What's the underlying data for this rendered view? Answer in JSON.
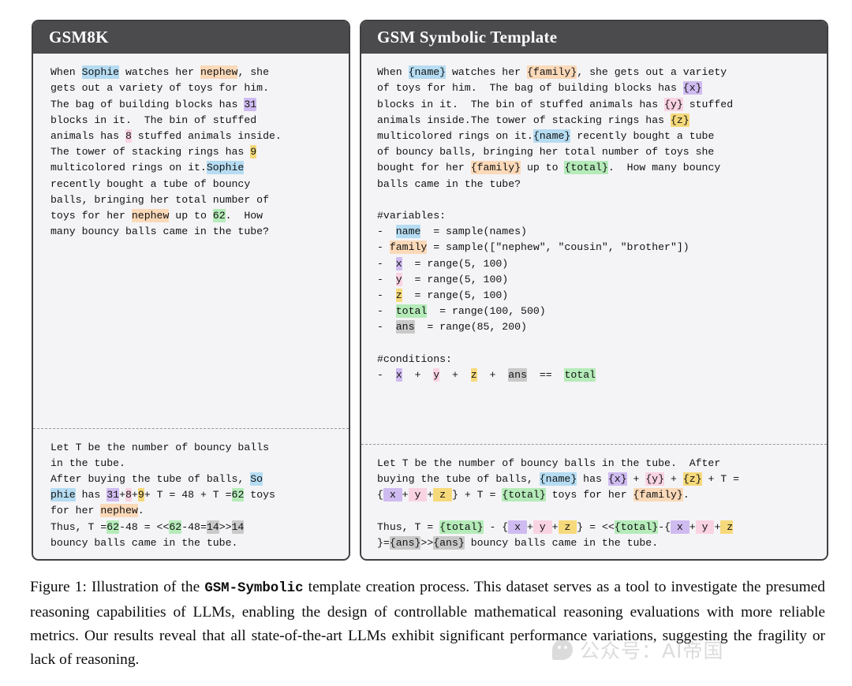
{
  "figure": {
    "panels": [
      {
        "id": "gsm8k",
        "title": "GSM8K",
        "question_tokens": [
          {
            "t": "When ",
            "h": null
          },
          {
            "t": "Sophie",
            "h": "blue"
          },
          {
            "t": " watches her ",
            "h": null
          },
          {
            "t": "nephew",
            "h": "orange"
          },
          {
            "t": ", she\ngets out a variety of toys for him.\nThe bag of building blocks has ",
            "h": null
          },
          {
            "t": "31",
            "h": "purple"
          },
          {
            "t": "\nblocks in it.  The bin of stuffed\nanimals has ",
            "h": null
          },
          {
            "t": "8",
            "h": "pink"
          },
          {
            "t": " stuffed animals inside.\nThe tower of stacking rings has ",
            "h": null
          },
          {
            "t": "9",
            "h": "yellow"
          },
          {
            "t": "\nmulticolored rings on it.",
            "h": null
          },
          {
            "t": "Sophie",
            "h": "blue"
          },
          {
            "t": "\nrecently bought a tube of bouncy\nballs, bringing her total number of\ntoys for her ",
            "h": null
          },
          {
            "t": "nephew",
            "h": "orange"
          },
          {
            "t": " up to ",
            "h": null
          },
          {
            "t": "62",
            "h": "green"
          },
          {
            "t": ".  How\nmany bouncy balls came in the tube?",
            "h": null
          }
        ],
        "answer_tokens": [
          {
            "t": "Let T be the number of bouncy balls\nin the tube.\nAfter buying the tube of balls, ",
            "h": null
          },
          {
            "t": "So",
            "h": "blue"
          },
          {
            "t": "\n",
            "h": null
          },
          {
            "t": "phie",
            "h": "blue"
          },
          {
            "t": " has ",
            "h": null
          },
          {
            "t": "31",
            "h": "purple"
          },
          {
            "t": "+",
            "h": null
          },
          {
            "t": "8",
            "h": "pink"
          },
          {
            "t": "+",
            "h": null
          },
          {
            "t": "9",
            "h": "yellow"
          },
          {
            "t": "+ T = 48 + T =",
            "h": null
          },
          {
            "t": "62",
            "h": "green"
          },
          {
            "t": " toys\nfor her ",
            "h": null
          },
          {
            "t": "nephew",
            "h": "orange"
          },
          {
            "t": ".\nThus, T =",
            "h": null
          },
          {
            "t": "62",
            "h": "green"
          },
          {
            "t": "-48 = <<",
            "h": null
          },
          {
            "t": "62",
            "h": "green"
          },
          {
            "t": "-48=",
            "h": null
          },
          {
            "t": "14",
            "h": "gray"
          },
          {
            "t": ">>",
            "h": null
          },
          {
            "t": "14",
            "h": "gray"
          },
          {
            "t": "\nbouncy balls came in the tube.",
            "h": null
          }
        ]
      },
      {
        "id": "gsm-symbolic",
        "title": "GSM Symbolic Template",
        "question_tokens": [
          {
            "t": "When ",
            "h": null
          },
          {
            "t": "{name}",
            "h": "blue"
          },
          {
            "t": " watches her ",
            "h": null
          },
          {
            "t": "{family}",
            "h": "orange"
          },
          {
            "t": ", she gets out a variety\nof toys for him.  The bag of building blocks has ",
            "h": null
          },
          {
            "t": "{x}",
            "h": "purple"
          },
          {
            "t": "\nblocks in it.  The bin of stuffed animals has ",
            "h": null
          },
          {
            "t": "{y}",
            "h": "pink"
          },
          {
            "t": " stuffed\nanimals inside.The tower of stacking rings has ",
            "h": null
          },
          {
            "t": "{z}",
            "h": "yellow"
          },
          {
            "t": "\nmulticolored rings on it.",
            "h": null
          },
          {
            "t": "{name}",
            "h": "blue"
          },
          {
            "t": " recently bought a tube\nof bouncy balls, bringing her total number of toys she\nbought for her ",
            "h": null
          },
          {
            "t": "{family}",
            "h": "orange"
          },
          {
            "t": " up to ",
            "h": null
          },
          {
            "t": "{total}",
            "h": "green"
          },
          {
            "t": ".  How many bouncy\nballs came in the tube?\n\n#variables:\n-  ",
            "h": null
          },
          {
            "t": "name",
            "h": "blue"
          },
          {
            "t": "  = sample(names)\n- ",
            "h": null
          },
          {
            "t": "family",
            "h": "orange"
          },
          {
            "t": " = sample([\"nephew\", \"cousin\", \"brother\"])\n-  ",
            "h": null
          },
          {
            "t": "x",
            "h": "purple"
          },
          {
            "t": "  = range(5, 100)\n-  ",
            "h": null
          },
          {
            "t": "y",
            "h": "pink"
          },
          {
            "t": "  = range(5, 100)\n-  ",
            "h": null
          },
          {
            "t": "z",
            "h": "yellow"
          },
          {
            "t": "  = range(5, 100)\n-  ",
            "h": null
          },
          {
            "t": "total",
            "h": "green"
          },
          {
            "t": "  = range(100, 500)\n-  ",
            "h": null
          },
          {
            "t": "ans",
            "h": "gray"
          },
          {
            "t": "  = range(85, 200)\n\n#conditions:\n-  ",
            "h": null
          },
          {
            "t": "x",
            "h": "purple"
          },
          {
            "t": "  +  ",
            "h": null
          },
          {
            "t": "y",
            "h": "pink"
          },
          {
            "t": "  +  ",
            "h": null
          },
          {
            "t": "z",
            "h": "yellow"
          },
          {
            "t": "  +  ",
            "h": null
          },
          {
            "t": "ans",
            "h": "gray"
          },
          {
            "t": "  ==  ",
            "h": null
          },
          {
            "t": "total",
            "h": "green"
          }
        ],
        "answer_tokens": [
          {
            "t": "Let T be the number of bouncy balls in the tube.  After\nbuying the tube of balls, ",
            "h": null
          },
          {
            "t": "{name}",
            "h": "blue"
          },
          {
            "t": " has ",
            "h": null
          },
          {
            "t": "{x}",
            "h": "purple"
          },
          {
            "t": " + ",
            "h": null
          },
          {
            "t": "{y}",
            "h": "pink"
          },
          {
            "t": " + ",
            "h": null
          },
          {
            "t": "{z}",
            "h": "yellow"
          },
          {
            "t": " + T =\n{",
            "h": null
          },
          {
            "t": " x ",
            "h": "purple"
          },
          {
            "t": "+",
            "h": null
          },
          {
            "t": " y ",
            "h": "pink"
          },
          {
            "t": "+",
            "h": null
          },
          {
            "t": " z ",
            "h": "yellow"
          },
          {
            "t": "} + T = ",
            "h": null
          },
          {
            "t": "{total}",
            "h": "green"
          },
          {
            "t": " toys for her ",
            "h": null
          },
          {
            "t": "{family}",
            "h": "orange"
          },
          {
            "t": ".\n\nThus, T = ",
            "h": null
          },
          {
            "t": "{total}",
            "h": "green"
          },
          {
            "t": " - {",
            "h": null
          },
          {
            "t": " x ",
            "h": "purple"
          },
          {
            "t": "+",
            "h": null
          },
          {
            "t": " y ",
            "h": "pink"
          },
          {
            "t": "+",
            "h": null
          },
          {
            "t": " z ",
            "h": "yellow"
          },
          {
            "t": "} = <<",
            "h": null
          },
          {
            "t": "{total}",
            "h": "green"
          },
          {
            "t": "-{",
            "h": null
          },
          {
            "t": " x ",
            "h": "purple"
          },
          {
            "t": "+",
            "h": null
          },
          {
            "t": " y ",
            "h": "pink"
          },
          {
            "t": "+",
            "h": null
          },
          {
            "t": " z\n",
            "h": "yellow"
          },
          {
            "t": "}=",
            "h": null
          },
          {
            "t": "{ans}",
            "h": "gray"
          },
          {
            "t": ">>",
            "h": null
          },
          {
            "t": "{ans}",
            "h": "gray"
          },
          {
            "t": " bouncy balls came in the tube.",
            "h": null
          }
        ]
      }
    ],
    "caption": {
      "part1": "Figure 1: Illustration of the ",
      "mono": "GSM-Symbolic",
      "part2": " template creation process.  This dataset serves as a tool to investigate the presumed reasoning capabilities of LLMs, enabling the design of controllable mathematical reasoning evaluations with more reliable metrics.  Our results reveal that all state-of-the-art LLMs exhibit significant performance variations, suggesting the fragility or lack of reasoning."
    },
    "watermark": {
      "text": "公众号：AI帝国",
      "icon": "wechat-icon"
    },
    "highlight_colors": {
      "blue": "#b5dcf2",
      "orange": "#fbd9b9",
      "purple": "#cfbbf0",
      "pink": "#fad3e3",
      "yellow": "#f6d97a",
      "green": "#b5ebb9",
      "gray": "#c9c9c9",
      "header_bg": "#4b4b4e",
      "panel_bg": "#f4f4f6",
      "panel_border": "#3f3f42"
    }
  }
}
